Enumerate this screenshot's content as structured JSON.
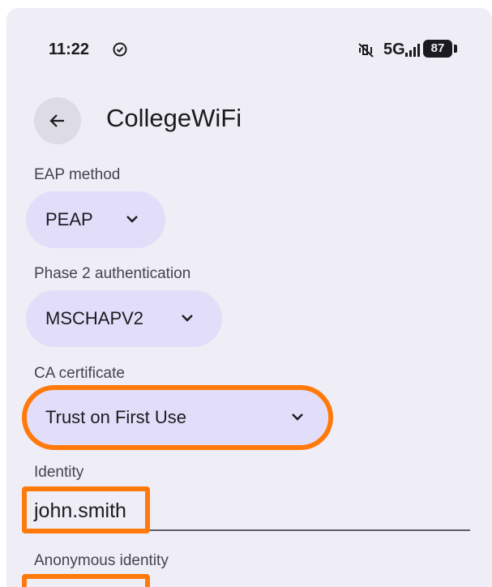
{
  "status_bar": {
    "time": "11:22",
    "network": "5G",
    "battery": "87"
  },
  "header": {
    "title": "CollegeWiFi"
  },
  "form": {
    "eap_label": "EAP method",
    "eap_value": "PEAP",
    "phase2_label": "Phase 2 authentication",
    "phase2_value": "MSCHAPV2",
    "ca_label": "CA certificate",
    "ca_value": "Trust on First Use",
    "identity_label": "Identity",
    "identity_value": "john.smith",
    "anon_label": "Anonymous identity"
  },
  "icons": {
    "back": "arrow-left-icon",
    "status_check": "check-circle-icon",
    "mute": "vibrate-off-icon",
    "signal": "signal-bars-icon",
    "chevron": "chevron-down-icon"
  },
  "colors": {
    "background": "#efedf6",
    "chip": "#e2defa",
    "highlight": "#ff7a0a"
  }
}
